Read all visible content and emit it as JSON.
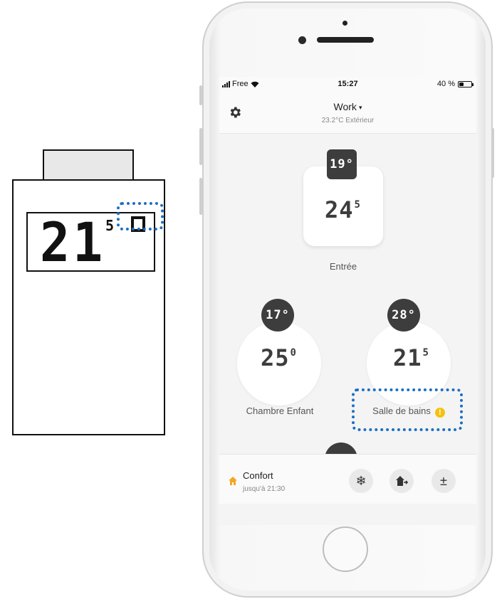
{
  "device": {
    "temperature": "21",
    "decimal": "5"
  },
  "status_bar": {
    "carrier": "Free",
    "time": "15:27",
    "battery_text": "40 %",
    "battery_level": 0.4
  },
  "header": {
    "home_name": "Work",
    "chevron": "▾",
    "outdoor": "23.2°C Extérieur"
  },
  "rooms": [
    {
      "name": "Entrée",
      "target": "19°",
      "current": "24",
      "current_decimal": "5"
    },
    {
      "name": "Chambre Enfant",
      "target": "17°",
      "current": "25",
      "current_decimal": "0"
    },
    {
      "name": "Salle de bains",
      "target": "28°",
      "current": "21",
      "current_decimal": "5",
      "warning": "!"
    }
  ],
  "bottom_bar": {
    "mode_title": "Confort",
    "mode_subtitle": "jusqu'à 21:30",
    "frost_icon": "❄",
    "plus_minus": "±"
  },
  "colors": {
    "annotation": "#1b6fc2",
    "warning": "#f4c20d",
    "home_icon": "#f5a623",
    "badge": "#3d3d3d"
  }
}
